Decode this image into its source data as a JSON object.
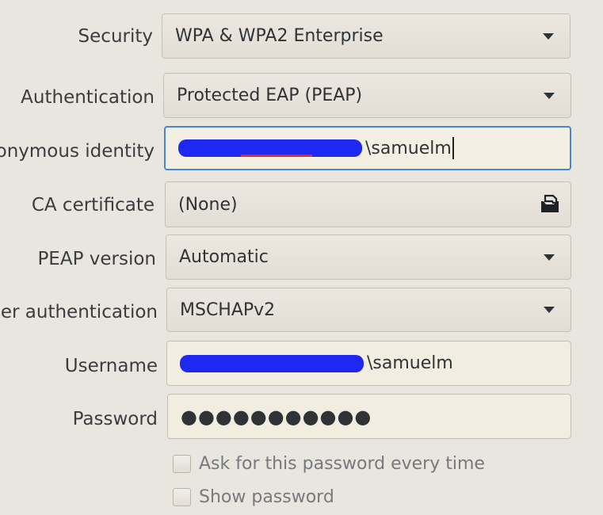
{
  "security": {
    "label": "Security",
    "value": "WPA & WPA2 Enterprise"
  },
  "authentication": {
    "label": "Authentication",
    "value": "Protected EAP (PEAP)"
  },
  "anonymous_identity": {
    "label": "Anonymous identity",
    "value_suffix": "\\samuelm"
  },
  "ca_certificate": {
    "label": "CA certificate",
    "value": "(None)",
    "icon": "file-open-icon"
  },
  "peap_version": {
    "label": "PEAP version",
    "value": "Automatic"
  },
  "inner_authentication": {
    "label": "Inner authentication",
    "value": "MSCHAPv2"
  },
  "username": {
    "label": "Username",
    "value_suffix": "\\samuelm"
  },
  "password": {
    "label": "Password",
    "value": "●●●●●●●●●●●"
  },
  "checkboxes": {
    "ask_every_time": {
      "label": "Ask for this password every time",
      "checked": false
    },
    "show_password": {
      "label": "Show password",
      "checked": false
    }
  },
  "colors": {
    "focus": "#4a86cf",
    "redaction": "#1f28f0",
    "background": "#e9e5df"
  }
}
